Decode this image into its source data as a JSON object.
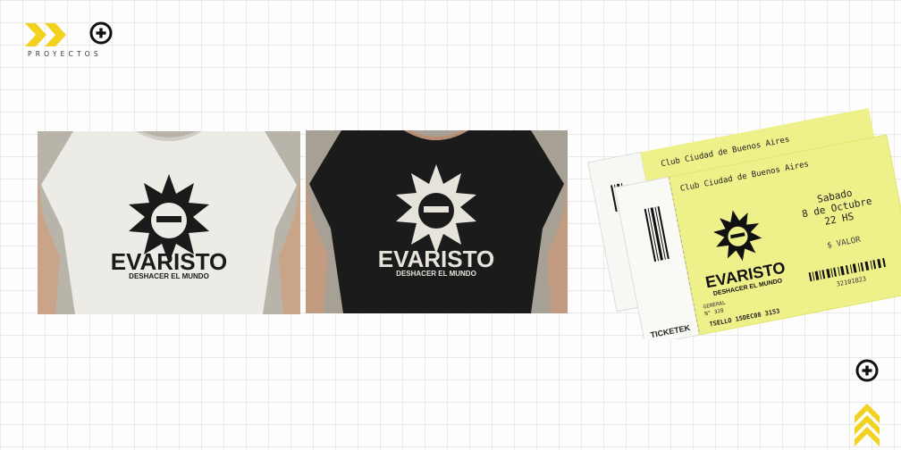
{
  "header": {
    "section_label": "PROYECTOS"
  },
  "icons": {
    "logo": "double-chevron-right-icon",
    "header_action": "plus-circle-icon",
    "footer_action": "plus-circle-icon",
    "scroll_top": "double-chevron-up-icon"
  },
  "colors": {
    "accent_yellow": "#f2d21f",
    "ticket_yellow": "#eef08a",
    "ink": "#1a1a1a",
    "white_shirt": "#ecebe6",
    "black_shirt": "#1b1b1b"
  },
  "gallery": {
    "shirt_white": {
      "brand": "EVARISTO",
      "tagline": "DESHACER EL MUNDO"
    },
    "shirt_black": {
      "brand": "EVARISTO",
      "tagline": "DESHACER EL MUNDO"
    },
    "ticket": {
      "venue": "Club Ciudad de Buenos Aires",
      "day": "Sabado",
      "date": "8 de Octubre",
      "time": "22 HS",
      "price": "$ VALOR",
      "brand": "EVARISTO",
      "tagline": "DESHACER EL MUNDO",
      "vendor": "TICKETEK",
      "serial": "TSELLO 15DEC08 3153",
      "barcode_number": "32101823",
      "seat_type": "GENERAL",
      "seat_number": "N° 328"
    }
  }
}
